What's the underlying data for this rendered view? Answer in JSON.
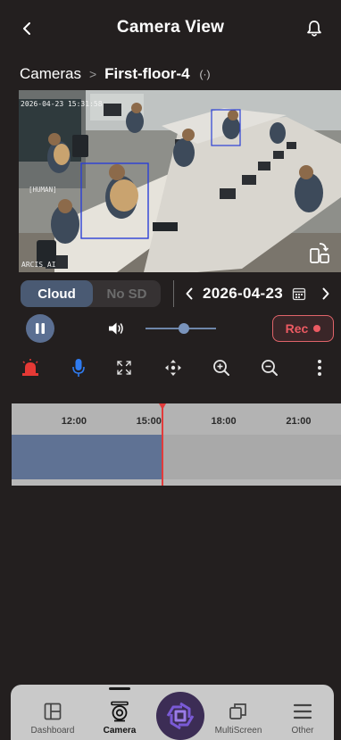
{
  "header": {
    "title": "Camera View",
    "icons": {
      "back": "chevron-left-icon",
      "notifications": "bell-icon"
    }
  },
  "breadcrumb": {
    "root": "Cameras",
    "separator": ">",
    "current": "First-floor-4",
    "status_icon": "live-signal-icon",
    "status_glyph": "(·)"
  },
  "video": {
    "timestamp": "2026-04-23 15:31:58",
    "watermark": "ARCIS AI",
    "detection_label": "[HUMAN]",
    "detection_color": "#2b3fd6",
    "rotate_icon": "rotate-screen-icon"
  },
  "storage": {
    "options": [
      "Cloud",
      "No SD"
    ],
    "selected": "Cloud",
    "active_color": "#4a5a73"
  },
  "date_nav": {
    "date": "2026-04-23",
    "prev_icon": "chevron-left-icon",
    "next_icon": "chevron-right-icon",
    "calendar_icon": "calendar-icon"
  },
  "playback": {
    "state_icon": "pause-icon",
    "volume_icon": "speaker-icon",
    "volume_level": 0.55,
    "record_label": "Rec",
    "record_color": "#ec5a62"
  },
  "toolbar": {
    "items": [
      {
        "name": "siren-icon",
        "color": "#e53935"
      },
      {
        "name": "microphone-icon",
        "color": "#2f7bf0"
      },
      {
        "name": "fullscreen-icon",
        "color": "#e6e6e6"
      },
      {
        "name": "ptz-move-icon",
        "color": "#e6e6e6"
      },
      {
        "name": "zoom-in-icon",
        "color": "#e6e6e6"
      },
      {
        "name": "zoom-out-icon",
        "color": "#e6e6e6"
      },
      {
        "name": "more-vertical-icon",
        "color": "#e6e6e6"
      }
    ]
  },
  "timeline": {
    "start_hour": 9.5,
    "end_hour": 22.7,
    "ticks": [
      "12:00",
      "15:00",
      "18:00",
      "21:00"
    ],
    "tick_hours": [
      12,
      15,
      18,
      21
    ],
    "recorded_until_hour": 15.55,
    "cursor_hour": 15.55,
    "recorded_color": "#5f7294",
    "cursor_color": "#e23b3b"
  },
  "bottom_nav": {
    "items": [
      {
        "label": "Dashboard",
        "icon": "dashboard-icon",
        "active": false
      },
      {
        "label": "Camera",
        "icon": "camera-icon",
        "active": true
      },
      {
        "label": "",
        "icon": "app-logo-icon",
        "active": false
      },
      {
        "label": "MultiScreen",
        "icon": "multiscreen-icon",
        "active": false
      },
      {
        "label": "Other",
        "icon": "menu-icon",
        "active": false
      }
    ]
  }
}
